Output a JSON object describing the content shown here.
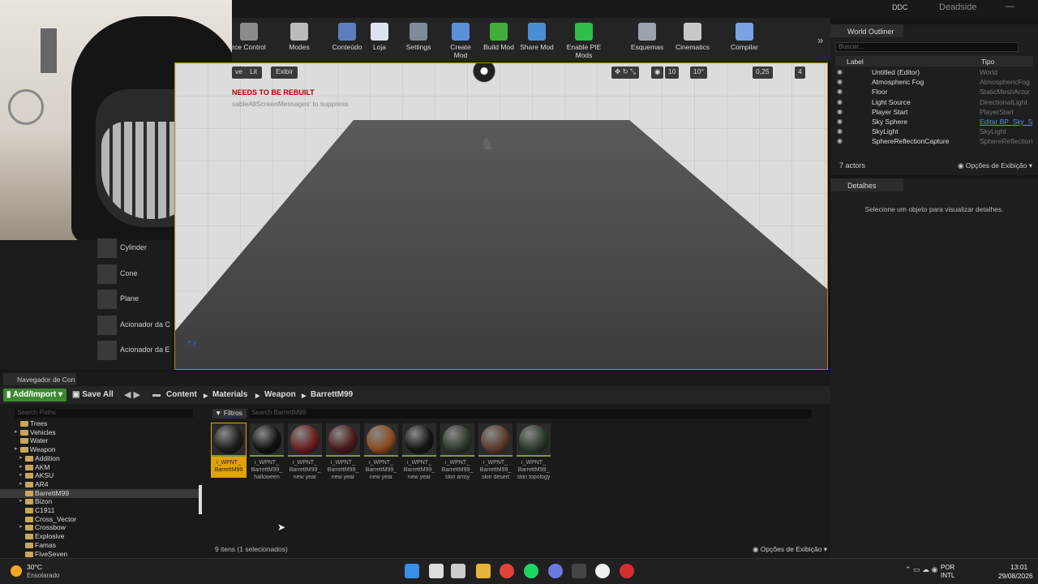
{
  "title_bar": {
    "ddc_label": "DDC",
    "project_name": "Deadside",
    "window_controls": "—"
  },
  "toolbar": {
    "items": [
      {
        "label": "rce Control",
        "color": "#8a8a8a"
      },
      {
        "label": "Modes",
        "color": "#bbbbbb"
      },
      {
        "label": "Conteúdo",
        "color": "#5d7dbf"
      },
      {
        "label": "Loja",
        "color": "#dde3ee"
      },
      {
        "label": "Settings",
        "color": "#7f8a99"
      },
      {
        "label": "Create Mod",
        "color": "#5b8fd6"
      },
      {
        "label": "Build Mod",
        "color": "#3fae3a"
      },
      {
        "label": "Share Mod",
        "color": "#4a8fd6"
      },
      {
        "label": "Enable PIE Mods",
        "color": "#2fbf4a"
      },
      {
        "label": "Esquemas",
        "color": "#9aa3ad"
      },
      {
        "label": "Cinematics",
        "color": "#c8c8c8"
      },
      {
        "label": "Compilar",
        "color": "#7aa3e6"
      }
    ],
    "more": "»"
  },
  "modes_panel": {
    "items": [
      "Cylinder",
      "Cone",
      "Plane",
      "Acionador da C",
      "Acionador da E"
    ]
  },
  "viewport": {
    "perspective": "ve",
    "lit": "Lit",
    "show": "Exibir",
    "warning": "NEEDS TO BE REBUILT",
    "hint": "sableAllScreenMessages' to suppress",
    "controls": {
      "grid": "10",
      "angle": "10°",
      "scale": "0,25",
      "cam": "4"
    }
  },
  "outliner": {
    "title": "World Outliner",
    "search_placeholder": "Buscar...",
    "col_label": "Label",
    "col_type": "Tipo",
    "rows": [
      {
        "name": "Untitled (Editor)",
        "type": "World"
      },
      {
        "name": "Atmospheric Fog",
        "type": "AtmosphericFog"
      },
      {
        "name": "Floor",
        "type": "StaticMeshActor"
      },
      {
        "name": "Light Source",
        "type": "DirectionalLight"
      },
      {
        "name": "Player Start",
        "type": "PlayerStart"
      },
      {
        "name": "Sky Sphere",
        "type": "Editar BP_Sky_Sp"
      },
      {
        "name": "SkyLight",
        "type": "SkyLight"
      },
      {
        "name": "SphereReflectionCapture",
        "type": "SphereReflectionC"
      }
    ],
    "actor_count": "7 actors",
    "view_options": "Opções de Exibição"
  },
  "details": {
    "title": "Detalhes",
    "message": "Selecione um objeto para visualizar detalhes."
  },
  "content_browser": {
    "tab": "Navegador de Con",
    "add_import": "Add/Import",
    "save_all": "Save All",
    "nav": "◀ ▶",
    "breadcrumbs": [
      "Content",
      "Materials",
      "Weapon",
      "BarrettM99"
    ],
    "path_search_placeholder": "Search Paths",
    "filters": "Filtros",
    "asset_search_placeholder": "Search BarrettM99",
    "tree": [
      {
        "name": "Trees",
        "indent": 1,
        "arrow": false,
        "selected": false
      },
      {
        "name": "Vehicles",
        "indent": 1,
        "arrow": true,
        "selected": false
      },
      {
        "name": "Water",
        "indent": 1,
        "arrow": false,
        "selected": false
      },
      {
        "name": "Weapon",
        "indent": 1,
        "arrow": true,
        "selected": false
      },
      {
        "name": "Addition",
        "indent": 2,
        "arrow": true,
        "selected": false
      },
      {
        "name": "AKM",
        "indent": 2,
        "arrow": true,
        "selected": false
      },
      {
        "name": "AKSU",
        "indent": 2,
        "arrow": true,
        "selected": false
      },
      {
        "name": "AR4",
        "indent": 2,
        "arrow": true,
        "selected": false
      },
      {
        "name": "BarrettM99",
        "indent": 2,
        "arrow": false,
        "selected": true
      },
      {
        "name": "Bizon",
        "indent": 2,
        "arrow": true,
        "selected": false
      },
      {
        "name": "C1911",
        "indent": 2,
        "arrow": false,
        "selected": false
      },
      {
        "name": "Cross_Vector",
        "indent": 2,
        "arrow": false,
        "selected": false
      },
      {
        "name": "Crossbow",
        "indent": 2,
        "arrow": true,
        "selected": false
      },
      {
        "name": "Explosive",
        "indent": 2,
        "arrow": false,
        "selected": false
      },
      {
        "name": "Famas",
        "indent": 2,
        "arrow": false,
        "selected": false
      },
      {
        "name": "FiveSeven",
        "indent": 2,
        "arrow": false,
        "selected": false
      }
    ],
    "assets": [
      {
        "l1": "i_WPNT_",
        "l2": "BarrettM99",
        "l3": "",
        "color": "#1e1e1e",
        "selected": true
      },
      {
        "l1": "i_WPNT_",
        "l2": "BarrettM99_",
        "l3": "halloween",
        "color": "#111111",
        "selected": false
      },
      {
        "l1": "i_WPNT_",
        "l2": "BarrettM99_",
        "l3": "new year",
        "color": "#6a1e1e",
        "selected": false
      },
      {
        "l1": "i_WPNT_",
        "l2": "BarrettM99_",
        "l3": "new year",
        "color": "#4a1a1a",
        "selected": false
      },
      {
        "l1": "i_WPNT_",
        "l2": "BarrettM99_",
        "l3": "new year",
        "color": "#8a4a1e",
        "selected": false
      },
      {
        "l1": "i_WPNT_",
        "l2": "BarrettM99_",
        "l3": "new year",
        "color": "#151515",
        "selected": false
      },
      {
        "l1": "i_WPNT_",
        "l2": "BarrettM99_",
        "l3": "skin army",
        "color": "#2e3a2a",
        "selected": false
      },
      {
        "l1": "i_WPNT_",
        "l2": "BarrettM99_",
        "l3": "skin desert",
        "color": "#5a3a2a",
        "selected": false
      },
      {
        "l1": "i_WPNT_",
        "l2": "BarrettM99_",
        "l3": "skin topology",
        "color": "#2a3a2a",
        "selected": false
      }
    ],
    "status": "9 itens (1 selecionados)",
    "view_options": "Opções de Exibição"
  },
  "taskbar": {
    "temperature": "30°C",
    "condition": "Ensolarado",
    "lang1": "POR",
    "lang2": "INTL",
    "time": "13:01",
    "date": "29/08/2026",
    "apps": [
      {
        "name": "windows",
        "color": "#3a8ee6"
      },
      {
        "name": "search",
        "color": "#dddddd"
      },
      {
        "name": "task-view",
        "color": "#cccccc"
      },
      {
        "name": "explorer",
        "color": "#e8b33a"
      },
      {
        "name": "chrome",
        "color": "#e0443a"
      },
      {
        "name": "spotify",
        "color": "#1ed760"
      },
      {
        "name": "discord",
        "color": "#6c7ae0"
      },
      {
        "name": "terminal",
        "color": "#444444"
      },
      {
        "name": "unreal",
        "color": "#f0f0f0"
      },
      {
        "name": "app",
        "color": "#d03030"
      }
    ]
  }
}
